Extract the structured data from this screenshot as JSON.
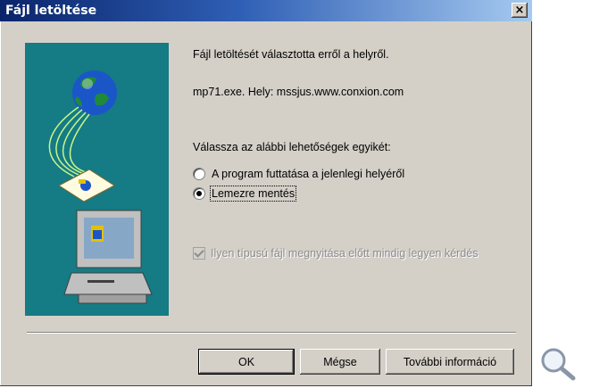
{
  "window": {
    "title": "Fájl letöltése",
    "close_glyph": "×"
  },
  "content": {
    "line1": "Fájl letöltését választotta erről a helyről.",
    "line2": "mp71.exe. Hely: mssjus.www.conxion.com",
    "prompt": "Válassza az alábbi lehetőségek egyikét:",
    "options": [
      {
        "label": "A program futtatása a jelenlegi helyéről",
        "selected": false
      },
      {
        "label": "Lemezre mentés",
        "selected": true
      }
    ],
    "checkbox": {
      "label": "Ilyen típusú fájl megnyitása előtt mindig legyen kérdés",
      "checked": true,
      "disabled": true
    }
  },
  "buttons": {
    "ok": "OK",
    "cancel": "Mégse",
    "more": "További információ"
  },
  "icons": {
    "illustration": "download-illustration",
    "globe": "globe-icon",
    "document": "document-icon",
    "computer": "computer-icon",
    "magnifier": "magnifier-icon"
  },
  "colors": {
    "title_bar": "#0a246a",
    "dialog_face": "#d4d0c8",
    "art_panel": "#157b84"
  }
}
